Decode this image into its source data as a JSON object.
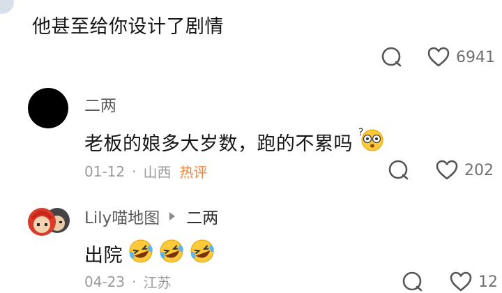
{
  "top_comment": {
    "text": "他甚至给你设计了剧情",
    "like_count": "6941"
  },
  "comment": {
    "username": "二两",
    "text": "老板的娘多大岁数，跑的不累吗",
    "date": "01-12",
    "separator": "·",
    "location": "山西",
    "hot_label": "热评",
    "like_count": "202"
  },
  "reply": {
    "username": "Lily喵地图",
    "reply_to": "二两",
    "text": "出院",
    "date": "04-23",
    "separator": "·",
    "location": "江苏",
    "like_count": "12"
  },
  "colors": {
    "hot": "#f3823a",
    "meta": "#9a9a9a",
    "text": "#151515"
  },
  "icons": [
    "comment-icon",
    "heart-icon",
    "flushed-face-emoji",
    "rolling-laughing-emoji",
    "play-triangle-icon"
  ]
}
